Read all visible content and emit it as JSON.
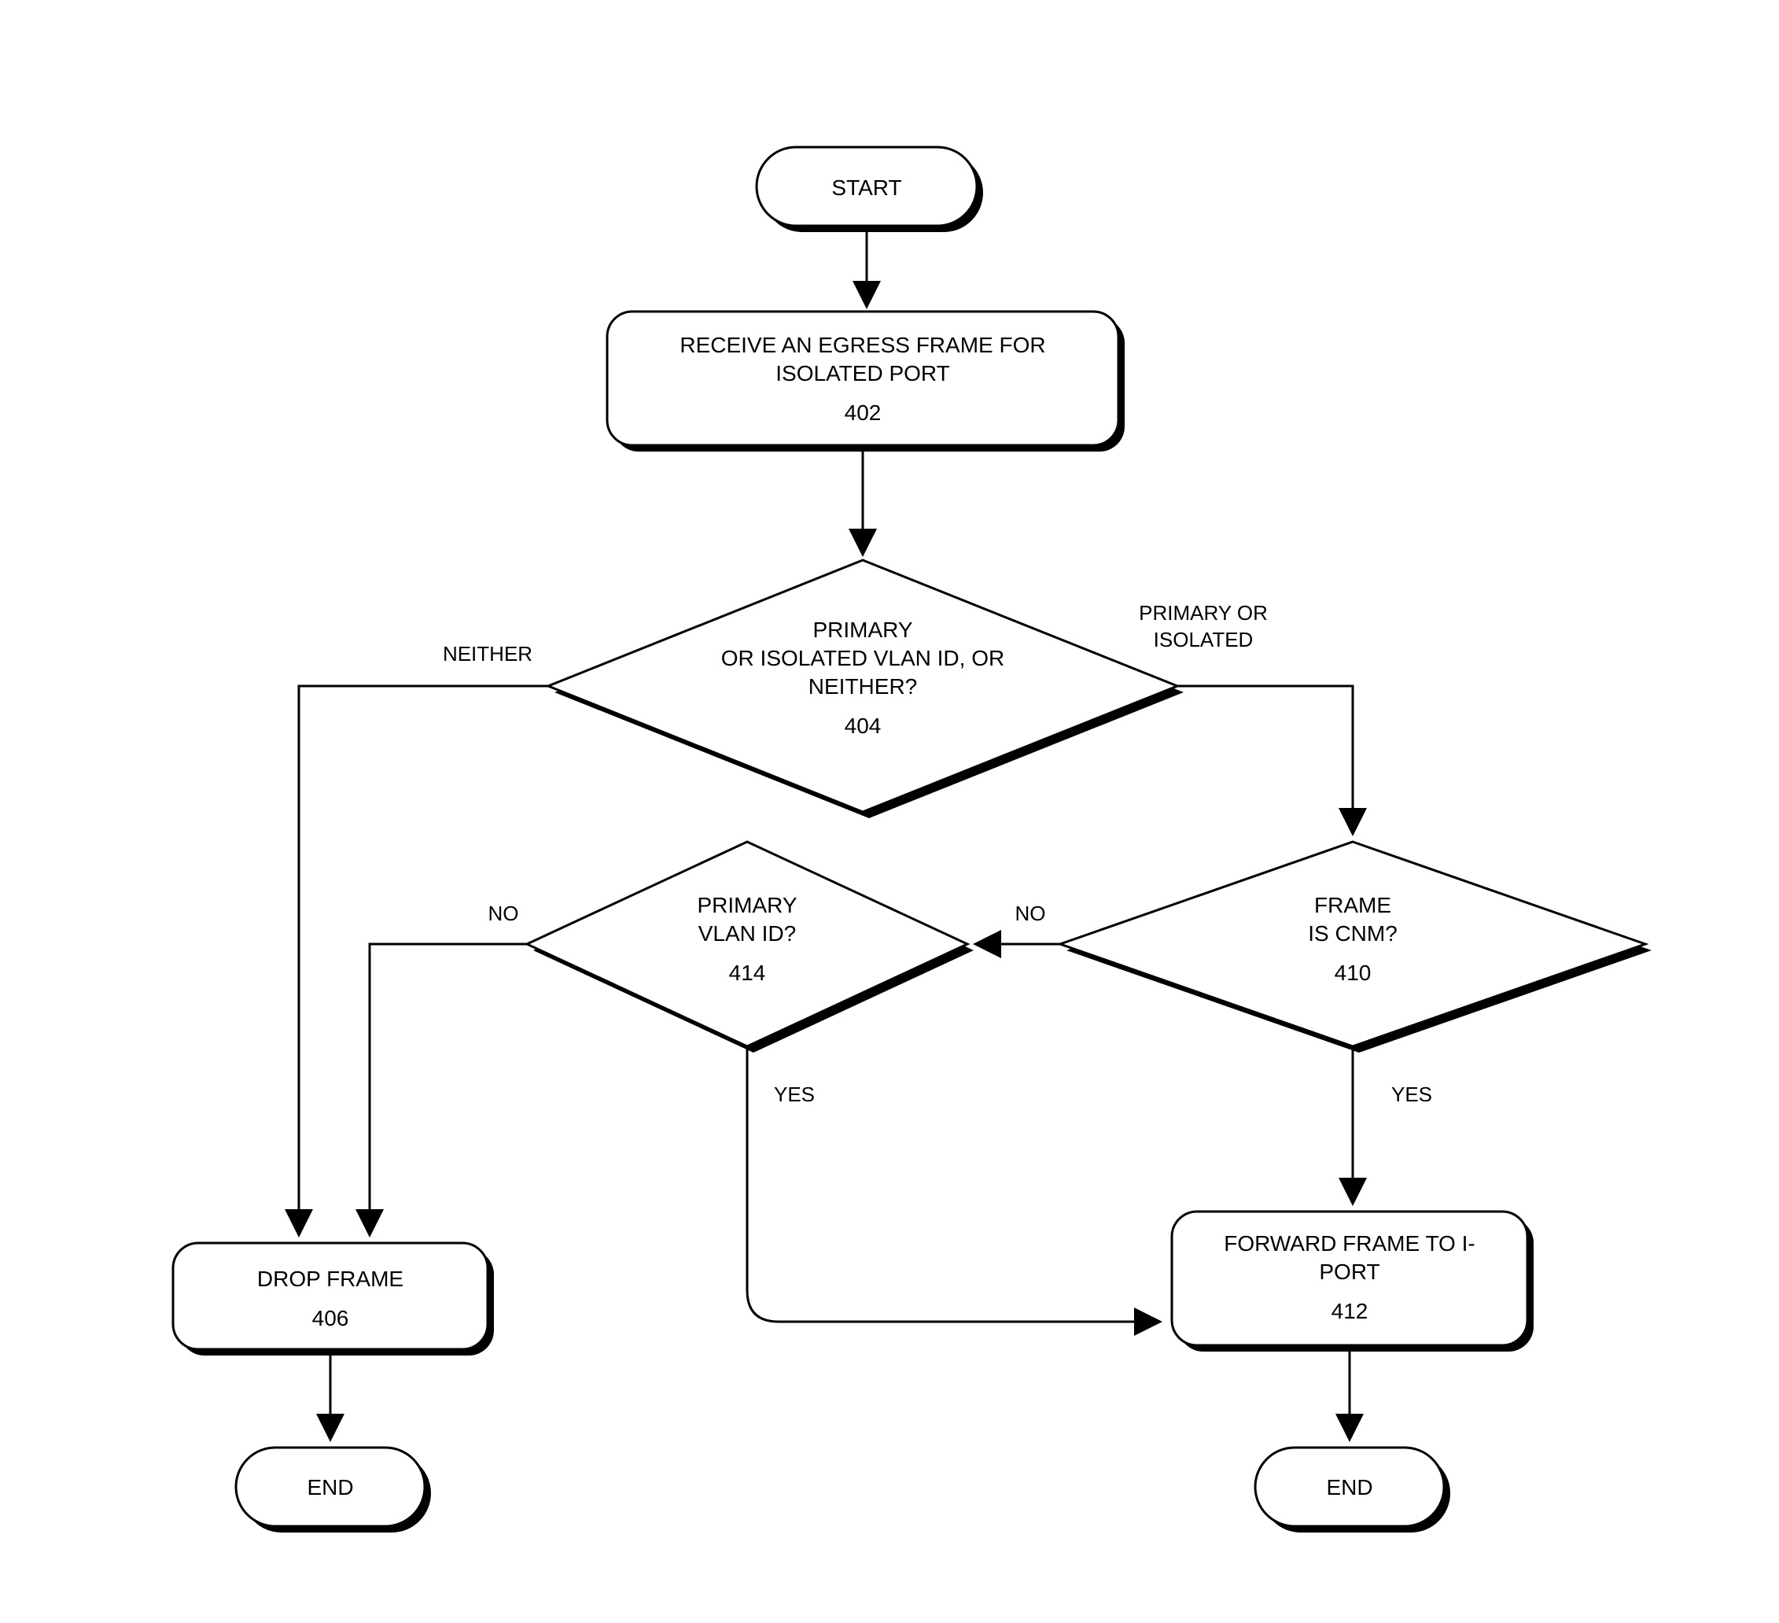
{
  "chart_data": {
    "type": "flowchart",
    "nodes": [
      {
        "id": "start",
        "kind": "terminator",
        "label": "START"
      },
      {
        "id": "402",
        "kind": "process",
        "lines": [
          "RECEIVE AN EGRESS FRAME FOR",
          "ISOLATED PORT",
          "402"
        ]
      },
      {
        "id": "404",
        "kind": "decision",
        "lines": [
          "PRIMARY",
          "OR ISOLATED VLAN ID, OR",
          "NEITHER?",
          "404"
        ]
      },
      {
        "id": "410",
        "kind": "decision",
        "lines": [
          "FRAME",
          "IS CNM?",
          "410"
        ]
      },
      {
        "id": "414",
        "kind": "decision",
        "lines": [
          "PRIMARY",
          "VLAN ID?",
          "414"
        ]
      },
      {
        "id": "406",
        "kind": "process",
        "lines": [
          "DROP FRAME",
          "406"
        ]
      },
      {
        "id": "412",
        "kind": "process",
        "lines": [
          "FORWARD FRAME TO I-",
          "PORT",
          "412"
        ]
      },
      {
        "id": "end1",
        "kind": "terminator",
        "label": "END"
      },
      {
        "id": "end2",
        "kind": "terminator",
        "label": "END"
      }
    ],
    "edges": [
      {
        "from": "start",
        "to": "402"
      },
      {
        "from": "402",
        "to": "404"
      },
      {
        "from": "404",
        "to": "406",
        "label": "NEITHER"
      },
      {
        "from": "404",
        "to": "410",
        "label": "PRIMARY OR ISOLATED"
      },
      {
        "from": "410",
        "to": "412",
        "label": "YES"
      },
      {
        "from": "410",
        "to": "414",
        "label": "NO"
      },
      {
        "from": "414",
        "to": "406",
        "label": "NO"
      },
      {
        "from": "414",
        "to": "412",
        "label": "YES"
      },
      {
        "from": "406",
        "to": "end1"
      },
      {
        "from": "412",
        "to": "end2"
      }
    ]
  },
  "nodes": {
    "start": "START",
    "n402_l1": "RECEIVE AN EGRESS FRAME FOR",
    "n402_l2": "ISOLATED PORT",
    "n402_l3": "402",
    "n404_l1": "PRIMARY",
    "n404_l2": "OR ISOLATED VLAN ID, OR",
    "n404_l3": "NEITHER?",
    "n404_l4": "404",
    "n410_l1": "FRAME",
    "n410_l2": "IS CNM?",
    "n410_l3": "410",
    "n414_l1": "PRIMARY",
    "n414_l2": "VLAN ID?",
    "n414_l3": "414",
    "n406_l1": "DROP FRAME",
    "n406_l2": "406",
    "n412_l1": "FORWARD FRAME TO I-",
    "n412_l2": "PORT",
    "n412_l3": "412",
    "end": "END"
  },
  "labels": {
    "neither": "NEITHER",
    "primary_or_isolated_l1": "PRIMARY OR",
    "primary_or_isolated_l2": "ISOLATED",
    "no": "NO",
    "yes": "YES"
  }
}
